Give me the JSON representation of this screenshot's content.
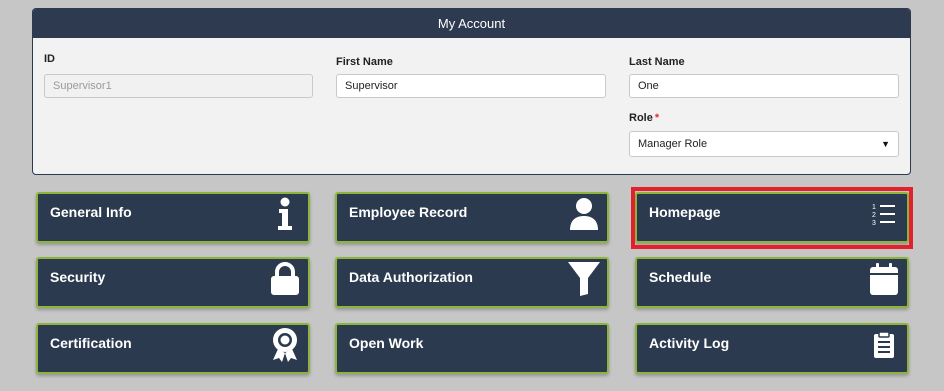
{
  "account": {
    "title": "My Account",
    "id_label": "ID",
    "id_value": "Supervisor1",
    "first_name_label": "First Name",
    "first_name_value": "Supervisor",
    "last_name_label": "Last Name",
    "last_name_value": "One",
    "role_label": "Role",
    "role_required": "*",
    "role_value": "Manager Role"
  },
  "tiles": {
    "general_info": {
      "label": "General Info",
      "icon": "info-icon"
    },
    "employee_record": {
      "label": "Employee Record",
      "icon": "user-icon"
    },
    "homepage": {
      "label": "Homepage",
      "icon": "numbered-list-icon"
    },
    "security": {
      "label": "Security",
      "icon": "lock-icon"
    },
    "data_authorization": {
      "label": "Data Authorization",
      "icon": "filter-icon"
    },
    "schedule": {
      "label": "Schedule",
      "icon": "calendar-icon"
    },
    "certification": {
      "label": "Certification",
      "icon": "award-icon"
    },
    "open_work": {
      "label": "Open Work",
      "icon": ""
    },
    "activity_log": {
      "label": "Activity Log",
      "icon": "clipboard-icon"
    }
  },
  "colors": {
    "tile_bg": "#2c3a4f",
    "tile_border": "#8db53b",
    "highlight": "#e3202b",
    "page_bg": "#c6c6c6"
  }
}
